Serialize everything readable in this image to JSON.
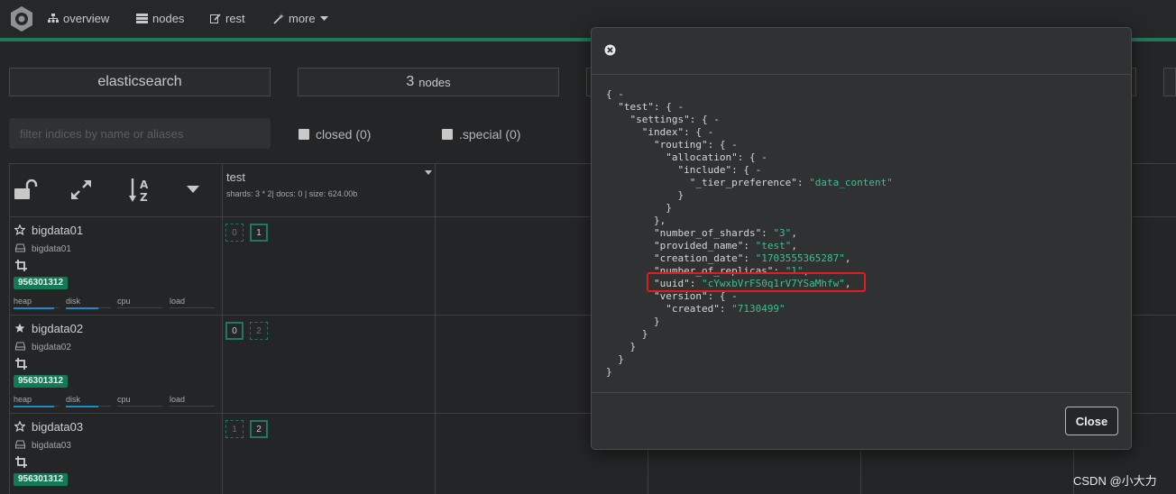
{
  "nav": {
    "overview": "overview",
    "nodes": "nodes",
    "rest": "rest",
    "more": "more"
  },
  "cluster": {
    "name": "elasticsearch",
    "nodes_count": "3",
    "nodes_label": "nodes"
  },
  "filters": {
    "search_placeholder": "filter indices by name or aliases",
    "closed_label": "closed (0)",
    "special_label": ".special (0)"
  },
  "index": {
    "name": "test",
    "meta": "shards: 3 * 2| docs: 0 | size: 624.00b"
  },
  "nodes": [
    {
      "name": "bigdata01",
      "host": "bigdata01",
      "badge": "956301312",
      "master": false,
      "metrics": [
        "heap",
        "disk",
        "cpu",
        "load"
      ],
      "shards": [
        {
          "label": "0",
          "primary": false
        },
        {
          "label": "1",
          "primary": true
        }
      ]
    },
    {
      "name": "bigdata02",
      "host": "bigdata02",
      "badge": "956301312",
      "master": true,
      "metrics": [
        "heap",
        "disk",
        "cpu",
        "load"
      ],
      "shards": [
        {
          "label": "0",
          "primary": true
        },
        {
          "label": "2",
          "primary": false
        }
      ]
    },
    {
      "name": "bigdata03",
      "host": "bigdata03",
      "badge": "956301312",
      "master": false,
      "metrics": [
        "heap",
        "disk",
        "cpu",
        "load"
      ],
      "shards": [
        {
          "label": "1",
          "primary": false
        },
        {
          "label": "2",
          "primary": true
        }
      ]
    }
  ],
  "modal": {
    "json_lines": [
      [
        {
          "t": "{ -"
        }
      ],
      [
        {
          "t": "  \"test\": { -"
        }
      ],
      [
        {
          "t": "    \"settings\": { -"
        }
      ],
      [
        {
          "t": "      \"index\": { -"
        }
      ],
      [
        {
          "t": "        \"routing\": { -"
        }
      ],
      [
        {
          "t": "          \"allocation\": { -"
        }
      ],
      [
        {
          "t": "            \"include\": { -"
        }
      ],
      [
        {
          "t": "              \"_tier_preference\": "
        },
        {
          "t": "\"data_content\"",
          "s": true
        }
      ],
      [
        {
          "t": "            }"
        }
      ],
      [
        {
          "t": "          }"
        }
      ],
      [
        {
          "t": "        },"
        }
      ],
      [
        {
          "t": "        \"number_of_shards\": "
        },
        {
          "t": "\"3\"",
          "s": true
        },
        {
          "t": ","
        }
      ],
      [
        {
          "t": "        \"provided_name\": "
        },
        {
          "t": "\"test\"",
          "s": true
        },
        {
          "t": ","
        }
      ],
      [
        {
          "t": "        \"creation_date\": "
        },
        {
          "t": "\"1703555365287\"",
          "s": true
        },
        {
          "t": ","
        }
      ],
      [
        {
          "t": "        \"number_of_replicas\": "
        },
        {
          "t": "\"1\"",
          "s": true
        },
        {
          "t": ","
        }
      ],
      [
        {
          "t": "        \"uuid\": "
        },
        {
          "t": "\"cYwxbVrFS0q1rV7YSaMhfw\"",
          "s": true
        },
        {
          "t": ","
        }
      ],
      [
        {
          "t": "        \"version\": { -"
        }
      ],
      [
        {
          "t": "          \"created\": "
        },
        {
          "t": "\"7130499\"",
          "s": true
        }
      ],
      [
        {
          "t": "        }"
        }
      ],
      [
        {
          "t": "      }"
        }
      ],
      [
        {
          "t": "    }"
        }
      ],
      [
        {
          "t": "  }"
        }
      ],
      [
        {
          "t": "}"
        }
      ]
    ],
    "close_label": "Close"
  },
  "watermark": "CSDN @小大力",
  "colors": {
    "accent": "#1e7a5a",
    "badge": "#127a55",
    "json_string": "#3fbf8e",
    "highlight": "#e21c1c"
  }
}
